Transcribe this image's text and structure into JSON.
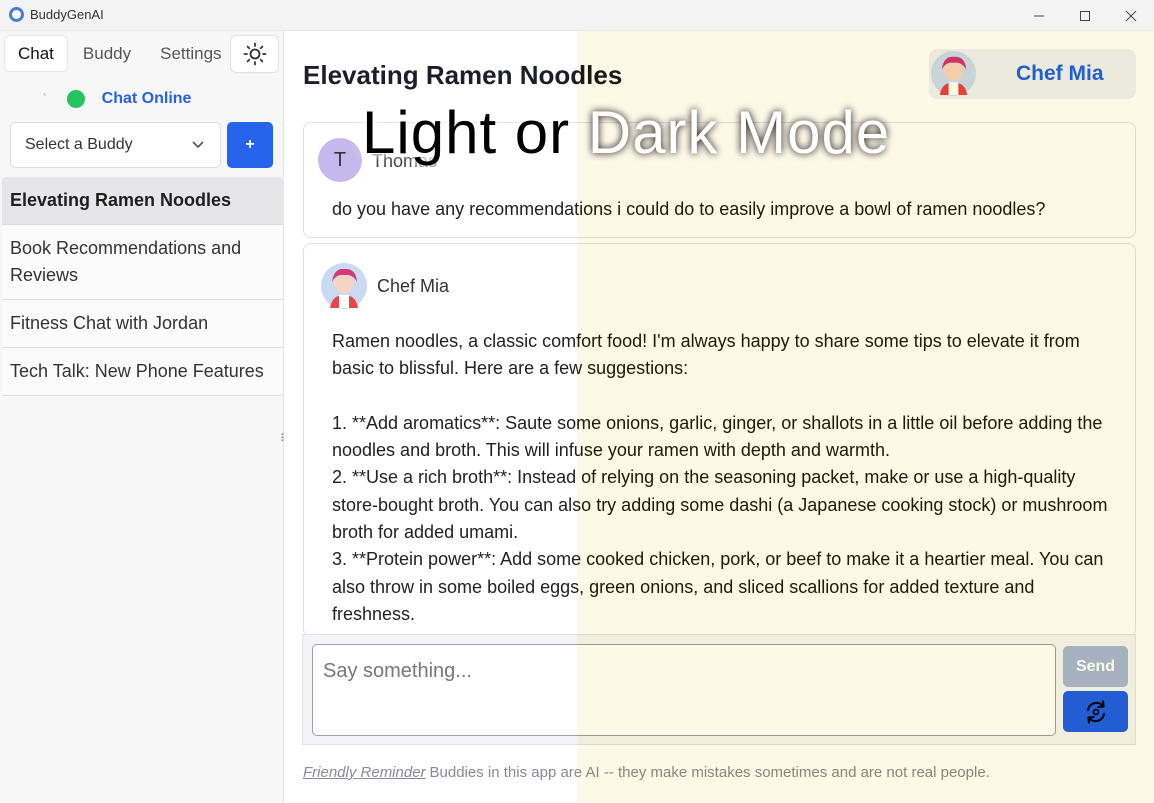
{
  "window": {
    "title": "BuddyGenAI",
    "controls": [
      "minimize",
      "maximize",
      "close"
    ]
  },
  "sidebar": {
    "tabs": [
      {
        "label": "Chat",
        "active": true
      },
      {
        "label": "Buddy",
        "active": false
      },
      {
        "label": "Settings",
        "active": false
      }
    ],
    "theme_icon": "sun-icon",
    "status_tick": "`",
    "status": "Chat Online",
    "select_placeholder": "Select a Buddy",
    "add_label": "+",
    "chats": [
      {
        "title": "Elevating Ramen Noodles",
        "active": true
      },
      {
        "title": "Book Recommendations and Reviews",
        "active": false
      },
      {
        "title": "Fitness Chat with Jordan",
        "active": false
      },
      {
        "title": "Tech Talk: New Phone Features",
        "active": false
      }
    ]
  },
  "main": {
    "title": "Elevating Ramen Noodles",
    "buddy_name": "Chef Mia",
    "messages": [
      {
        "author": "Thomas",
        "avatar_letter": "T",
        "text": "do you have any recommendations i could do to easily improve a bowl of ramen noodles?"
      },
      {
        "author": "Chef Mia",
        "lines": [
          "Ramen noodles, a classic comfort food! I'm always happy to share some tips to elevate it from",
          "basic to blissful. Here are a few suggestions:",
          "",
          "1. **Add aromatics**: Saute some onions, garlic, ginger, or shallots in a little oil before adding the",
          "noodles and broth. This will infuse your ramen with depth and warmth.",
          "2. **Use a rich broth**: Instead of relying on the seasoning packet, make or use a high-quality",
          "store-bought broth. You can also try adding some dashi (a Japanese cooking stock) or mushroom",
          "broth for added umami.",
          "3. **Protein power**: Add some cooked chicken, pork, or beef to make it a heartier meal. You can",
          "also throw in some boiled eggs, green onions, and sliced scallions for added texture and",
          "freshness."
        ]
      }
    ],
    "input_placeholder": "Say something...",
    "send_label": "Send",
    "regen_icon": "regenerate-icon",
    "reminder_link": "Friendly Reminder",
    "reminder_text": "Buddies in this app are AI -- they make mistakes sometimes and are not real people."
  },
  "overlay": {
    "caption_left": "Light or ",
    "caption_right": "Dark Mode"
  },
  "colors": {
    "accent": "#2563eb",
    "online": "#22c55e",
    "dark_bg": "#020618"
  }
}
